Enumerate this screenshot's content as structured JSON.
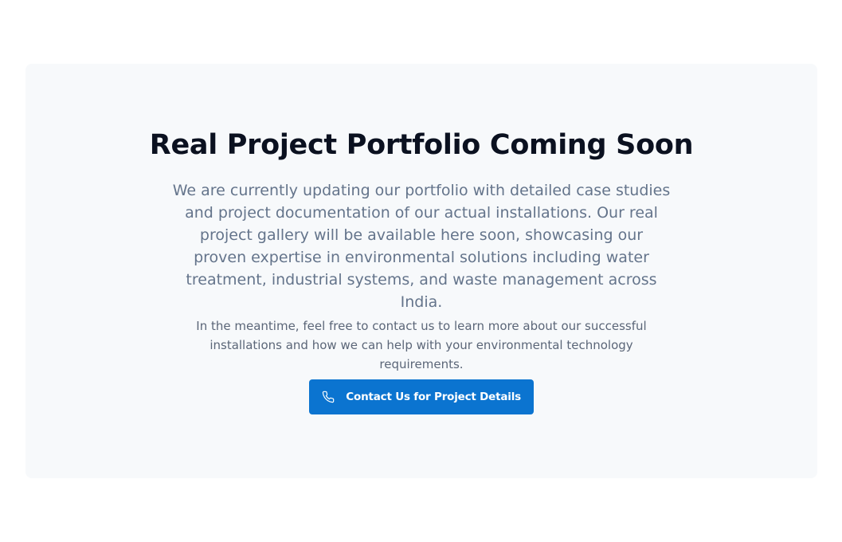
{
  "section": {
    "title": "Real Project Portfolio Coming Soon",
    "lead": "We are currently updating our portfolio with detailed case studies and project documentation of our actual installations. Our real project gallery will be available here soon, showcasing our proven expertise in environmental solutions including water treatment, industrial systems, and waste management across India.",
    "note": "In the meantime, feel free to contact us to learn more about our successful installations and how we can help with your environmental technology requirements.",
    "cta": {
      "label": "Contact Us for Project Details",
      "icon": "phone-icon"
    }
  },
  "colors": {
    "background": "#ffffff",
    "card": "#f7f9fb",
    "title": "#0b1120",
    "text": "#64748b",
    "accent": "#0b74d0"
  }
}
